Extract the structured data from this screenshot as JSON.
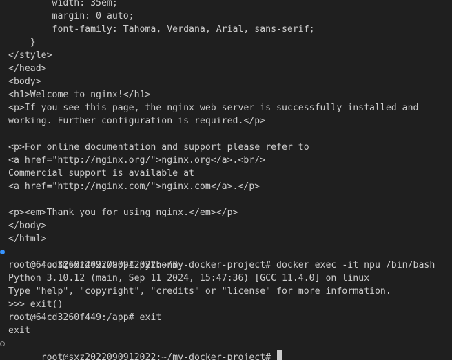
{
  "terminal": {
    "lines": [
      {
        "text": "        width: 35em;"
      },
      {
        "text": "        margin: 0 auto;"
      },
      {
        "text": "        font-family: Tahoma, Verdana, Arial, sans-serif;"
      },
      {
        "text": "    }"
      },
      {
        "text": "</style>"
      },
      {
        "text": "</head>"
      },
      {
        "text": "<body>"
      },
      {
        "text": "<h1>Welcome to nginx!</h1>"
      },
      {
        "text": "<p>If you see this page, the nginx web server is successfully installed and"
      },
      {
        "text": "working. Further configuration is required.</p>"
      },
      {
        "text": ""
      },
      {
        "text": "<p>For online documentation and support please refer to"
      },
      {
        "text": "<a href=\"http://nginx.org/\">nginx.org</a>.<br/>"
      },
      {
        "text": "Commercial support is available at"
      },
      {
        "text": "<a href=\"http://nginx.com/\">nginx.com</a>.</p>"
      },
      {
        "text": ""
      },
      {
        "text": "<p><em>Thank you for using nginx.</em></p>"
      },
      {
        "text": "</body>"
      },
      {
        "text": "</html>"
      },
      {
        "text": "root@sxz2022090912022:~/my-docker-project# docker exec -it npu /bin/bash"
      },
      {
        "text": "root@64cd3260f449:/app# python3"
      },
      {
        "text": "Python 3.10.12 (main, Sep 11 2024, 15:47:36) [GCC 11.4.0] on linux"
      },
      {
        "text": "Type \"help\", \"copyright\", \"credits\" or \"license\" for more information."
      },
      {
        "text": ">>> exit()"
      },
      {
        "text": "root@64cd3260f449:/app# exit"
      },
      {
        "text": "exit"
      },
      {
        "text": "root@sxz2022090912022:~/my-docker-project# "
      }
    ],
    "command_markers": {
      "completed_color": "#3794ff",
      "pending_color": "#8a8a8a"
    },
    "cursor_color": "#cccccc"
  }
}
